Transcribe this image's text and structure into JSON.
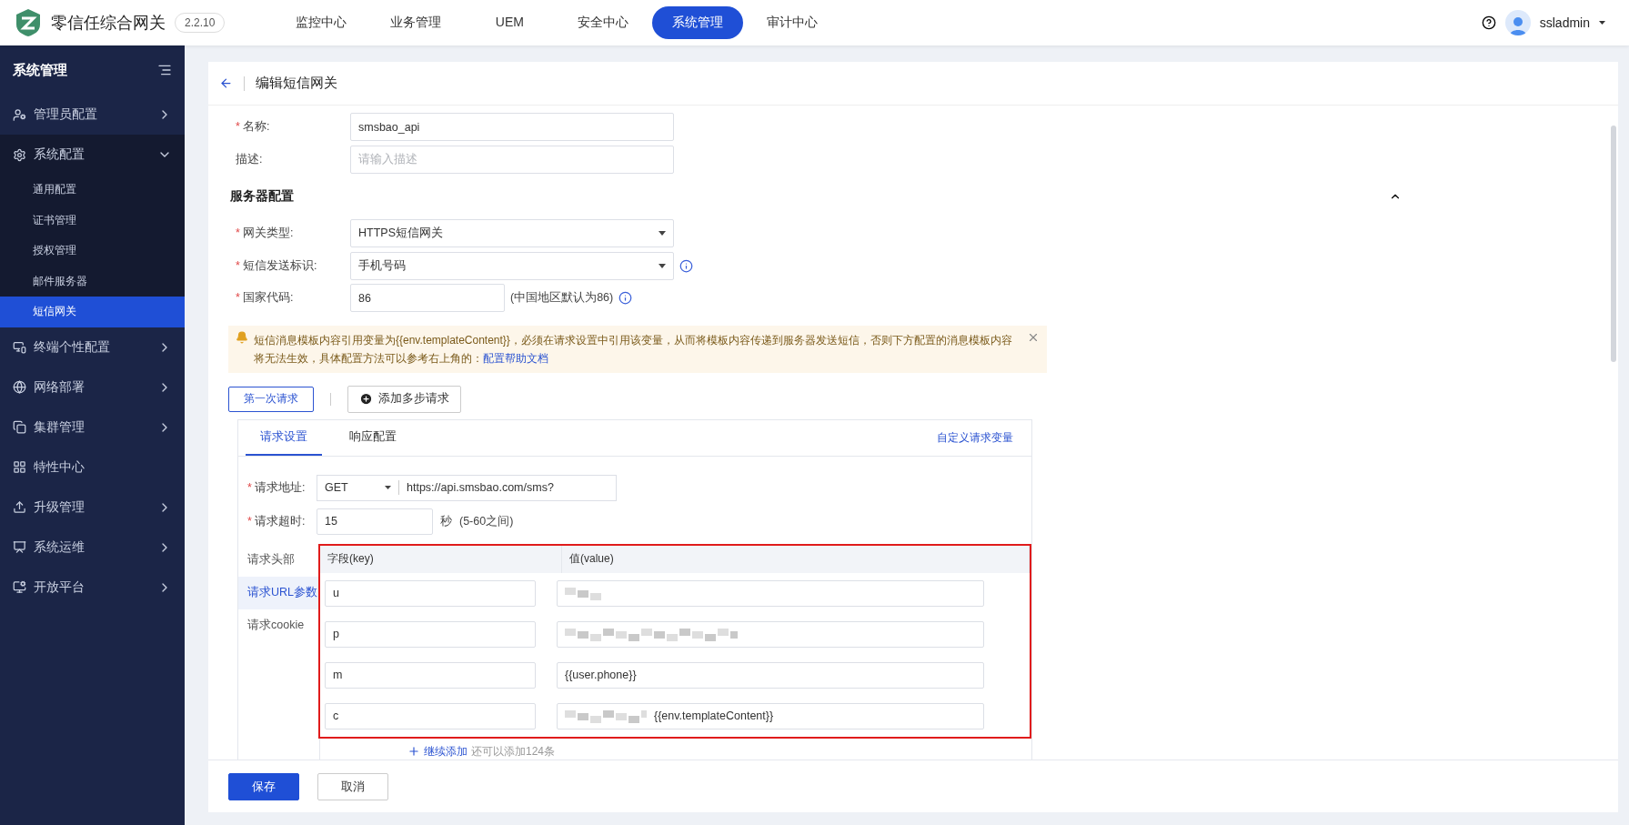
{
  "app": {
    "name": "零信任综合网关",
    "version": "2.2.10"
  },
  "top_nav": [
    {
      "label": "监控中心",
      "selected": false
    },
    {
      "label": "业务管理",
      "selected": false
    },
    {
      "label": "UEM",
      "selected": false
    },
    {
      "label": "安全中心",
      "selected": false
    },
    {
      "label": "系统管理",
      "selected": true
    },
    {
      "label": "审计中心",
      "selected": false
    }
  ],
  "user": {
    "name": "ssladmin"
  },
  "sidebar": {
    "title": "系统管理",
    "items": [
      {
        "label": "管理员配置",
        "expandable": true,
        "expanded": false
      },
      {
        "label": "系统配置",
        "expandable": true,
        "expanded": true,
        "children": [
          {
            "label": "通用配置",
            "selected": false
          },
          {
            "label": "证书管理",
            "selected": false
          },
          {
            "label": "授权管理",
            "selected": false
          },
          {
            "label": "邮件服务器",
            "selected": false
          },
          {
            "label": "短信网关",
            "selected": true
          }
        ]
      },
      {
        "label": "终端个性配置",
        "expandable": true,
        "expanded": false
      },
      {
        "label": "网络部署",
        "expandable": true,
        "expanded": false
      },
      {
        "label": "集群管理",
        "expandable": true,
        "expanded": false
      },
      {
        "label": "特性中心",
        "expandable": false,
        "expanded": false
      },
      {
        "label": "升级管理",
        "expandable": true,
        "expanded": false
      },
      {
        "label": "系统运维",
        "expandable": true,
        "expanded": false
      },
      {
        "label": "开放平台",
        "expandable": true,
        "expanded": false
      }
    ]
  },
  "page": {
    "title": "编辑短信网关"
  },
  "required_mark": "*",
  "basic_fields": [
    {
      "label": "名称:",
      "required": true,
      "kind": "input",
      "value": "smsbao_api"
    },
    {
      "label": "描述:",
      "required": false,
      "kind": "input",
      "placeholder": "请输入描述"
    }
  ],
  "server_section": {
    "title": "服务器配置",
    "expanded": true,
    "fields": [
      {
        "label": "网关类型:",
        "required": true,
        "kind": "select",
        "value": "HTTPS短信网关",
        "info": false
      },
      {
        "label": "短信发送标识:",
        "required": true,
        "kind": "select",
        "value": "手机号码",
        "info": true
      },
      {
        "label": "国家代码:",
        "required": true,
        "kind": "short",
        "value": "86",
        "hint": "(中国地区默认为86)",
        "info": true
      }
    ]
  },
  "notice": {
    "text": "短信消息模板内容引用变量为{{env.templateContent}}，必须在请求设置中引用该变量，从而将模板内容传递到服务器发送短信，否则下方配置的消息模板内容将无法生效，具体配置方法可以参考右上角的：",
    "link": "配置帮助文档"
  },
  "request_steps": [
    {
      "label": "第一次请求",
      "selected": true
    }
  ],
  "add_step": "添加多步请求",
  "request_tabs": [
    {
      "label": "请求设置",
      "selected": true
    },
    {
      "label": "响应配置",
      "selected": false
    }
  ],
  "custom_variables_link": "自定义请求变量",
  "request_url": {
    "required": true,
    "label": "请求地址:",
    "method": "GET",
    "url": "https://api.smsbao.com/sms?"
  },
  "request_timeout": {
    "required": true,
    "label": "请求超时:",
    "value": "15",
    "unit": "秒",
    "hint": "(5-60之间)"
  },
  "request_sections": [
    {
      "label": "请求头部",
      "selected": false
    },
    {
      "label": "请求URL参数",
      "selected": true
    },
    {
      "label": "请求cookie",
      "selected": false
    }
  ],
  "params_table": {
    "highlighted": true,
    "columns": [
      "字段(key)",
      "值(value)"
    ],
    "rows": [
      {
        "key": "u",
        "redacted": true
      },
      {
        "key": "p",
        "redacted": true
      },
      {
        "key": "m",
        "redacted": false,
        "value": "{{user.phone}}"
      },
      {
        "key": "c",
        "redacted": true,
        "value": "{{env.templateContent}}"
      }
    ]
  },
  "add_more": {
    "link": "继续添加",
    "note": "还可以添加124条"
  },
  "buttons": [
    {
      "label": "保存",
      "kind": "primary"
    },
    {
      "label": "取消",
      "kind": "default"
    }
  ]
}
